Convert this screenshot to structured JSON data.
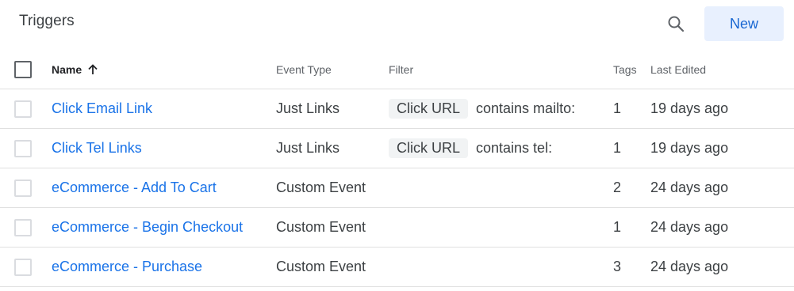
{
  "header": {
    "title": "Triggers",
    "new_label": "New"
  },
  "icons": {
    "search": "search-icon",
    "sort": "arrow-upward-icon"
  },
  "colors": {
    "link": "#1a73e8",
    "new_button_bg": "#e8f0fe",
    "new_button_text": "#1967d2"
  },
  "table": {
    "columns": {
      "name": "Name",
      "event_type": "Event Type",
      "filter": "Filter",
      "tags": "Tags",
      "last_edited": "Last Edited"
    },
    "sort": {
      "column": "Name",
      "direction": "ascending"
    },
    "rows": [
      {
        "name": "Click Email Link",
        "event_type": "Just Links",
        "filter_variable": "Click URL",
        "filter_condition": "contains mailto:",
        "tags": "1",
        "last_edited": "19 days ago"
      },
      {
        "name": "Click Tel Links",
        "event_type": "Just Links",
        "filter_variable": "Click URL",
        "filter_condition": "contains tel:",
        "tags": "1",
        "last_edited": "19 days ago"
      },
      {
        "name": "eCommerce - Add To Cart",
        "event_type": "Custom Event",
        "filter_variable": "",
        "filter_condition": "",
        "tags": "2",
        "last_edited": "24 days ago"
      },
      {
        "name": "eCommerce - Begin Checkout",
        "event_type": "Custom Event",
        "filter_variable": "",
        "filter_condition": "",
        "tags": "1",
        "last_edited": "24 days ago"
      },
      {
        "name": "eCommerce - Purchase",
        "event_type": "Custom Event",
        "filter_variable": "",
        "filter_condition": "",
        "tags": "3",
        "last_edited": "24 days ago"
      }
    ]
  }
}
